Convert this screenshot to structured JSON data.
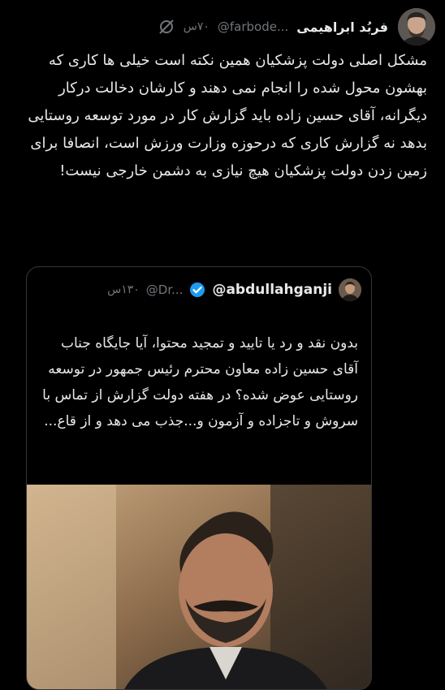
{
  "tweet": {
    "author_name": "فربُد ابراهیمی",
    "handle": "@farbode...",
    "time": "۷۰س",
    "body": "مشکل اصلی دولت پزشکیان همین نکته است خیلی ها کاری که بهشون محول شده را انجام نمی دهند و کارشان دخالت درکار دیگرانه، آقای حسین زاده باید گزارش کار در مورد توسعه روستایی بدهد نه گزارش کاری که درحوزه وزارت ورزش است، انصافا برای زمین زدن دولت پزشکیان هیچ نیازی به دشمن خارجی نیست!"
  },
  "quoted_tweet": {
    "author_name": "@abdullahganji",
    "handle": "@Dr...",
    "time": "۱۳۰س",
    "body": "بدون نقد و رد یا تایید و تمجید محتوا، آیا جایگاه جناب آقای حسین زاده معاون محترم رئیس جمهور در توسعه روستایی عوض شده؟ در هفته دولت گزارش از تماس با سروش و تاجزاده و آزمون و...جذب می دهد و از قاع..."
  },
  "colors": {
    "background": "#000000",
    "text": "#e7e9ea",
    "muted": "#71767b",
    "border": "#333639",
    "verified": "#1d9bf0"
  },
  "icons": [
    "avatar",
    "grok-icon",
    "verified-badge-icon",
    "quote-avatar",
    "media-image"
  ]
}
